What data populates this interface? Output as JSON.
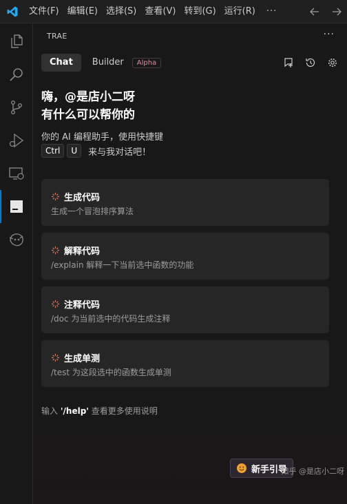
{
  "menu": {
    "items": [
      "文件(F)",
      "编辑(E)",
      "选择(S)",
      "查看(V)",
      "转到(G)",
      "运行(R)"
    ],
    "more": "···"
  },
  "panel": {
    "title": "TRAE",
    "more": "···"
  },
  "tabs": {
    "chat": "Chat",
    "builder": "Builder",
    "builder_badge": "Alpha"
  },
  "greeting": {
    "line1": "嗨，@是店小二呀",
    "line2": "有什么可以帮你的"
  },
  "intro": {
    "text": "你的 AI 编程助手，使用快捷键",
    "key1": "Ctrl",
    "key2": "U",
    "suffix": "来与我对话吧！"
  },
  "cards": [
    {
      "title": "生成代码",
      "desc": "生成一个冒泡排序算法"
    },
    {
      "title": "解释代码",
      "desc": "/explain 解释一下当前选中函数的功能"
    },
    {
      "title": "注释代码",
      "desc": "/doc 为当前选中的代码生成注释"
    },
    {
      "title": "生成单测",
      "desc": "/test 为这段选中的函数生成单测"
    }
  ],
  "help": {
    "prefix": "输入",
    "command": "'/help'",
    "suffix": "查看更多使用说明"
  },
  "guide_button": "新手引导",
  "watermark": "知乎 @是店小二呀",
  "colors": {
    "accent": "#0078d4",
    "badge": "#e88a9d",
    "spark": "#e07a5f"
  }
}
